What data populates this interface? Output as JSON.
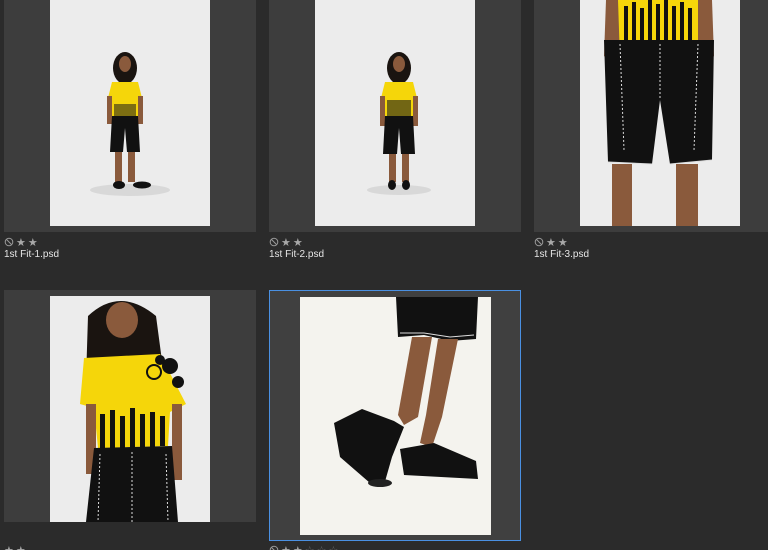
{
  "thumbnails": [
    {
      "filename": "1st Fit-1.psd",
      "rating": 2,
      "max_rating": 2,
      "subject": "full-length model photo",
      "selected": false
    },
    {
      "filename": "1st Fit-2.psd",
      "rating": 2,
      "max_rating": 2,
      "subject": "full-length model photo",
      "selected": false
    },
    {
      "filename": "1st Fit-3.psd",
      "rating": 2,
      "max_rating": 2,
      "subject": "shorts close-up photo",
      "selected": false
    },
    {
      "filename": "",
      "rating": 2,
      "max_rating": 2,
      "subject": "jersey close-up photo",
      "selected": false
    },
    {
      "filename": "",
      "rating": 2,
      "max_rating": 5,
      "subject": "shoes close-up photo",
      "selected": true
    }
  ],
  "colors": {
    "background": "#2b2b2b",
    "cell": "#3d3d3d",
    "selection": "#4a90e2",
    "jersey_yellow": "#f5d60a",
    "garment_black": "#111111"
  },
  "icons": {
    "reject": "reject-icon",
    "star": "star-icon"
  }
}
